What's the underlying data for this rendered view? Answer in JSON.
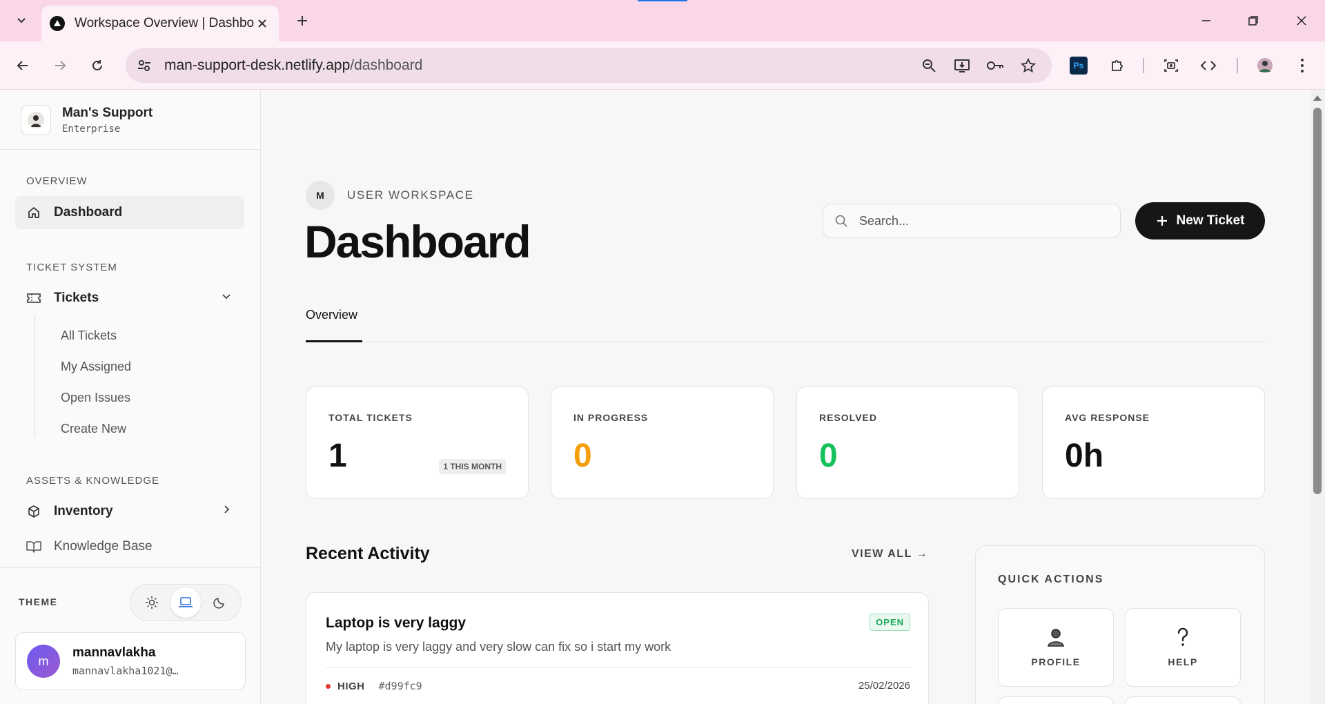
{
  "browser": {
    "tab_title": "Workspace Overview | Dashboa",
    "url_host": "man-support-desk.netlify.app",
    "url_path": "/dashboard"
  },
  "sidebar": {
    "brand_name": "Man's Support",
    "brand_sub": "Enterprise",
    "sections": {
      "overview": "OVERVIEW",
      "ticket_system": "TICKET SYSTEM",
      "assets": "ASSETS & KNOWLEDGE"
    },
    "items": {
      "dashboard": "Dashboard",
      "tickets": "Tickets",
      "inventory": "Inventory",
      "knowledge_base": "Knowledge Base"
    },
    "ticket_sub": [
      "All Tickets",
      "My Assigned",
      "Open Issues",
      "Create New"
    ],
    "theme_label": "THEME",
    "user": {
      "initial": "m",
      "name": "mannavlakha",
      "email": "mannavlakha1021@…"
    }
  },
  "main": {
    "workspace_initial": "M",
    "workspace_label": "USER WORKSPACE",
    "title": "Dashboard",
    "search_placeholder": "Search...",
    "new_ticket": "New Ticket",
    "tabs": [
      "Overview"
    ],
    "stats": [
      {
        "label": "TOTAL TICKETS",
        "value": "1",
        "badge": "1 THIS MONTH",
        "color": "#111111"
      },
      {
        "label": "IN PROGRESS",
        "value": "0",
        "color": "#f59e0b"
      },
      {
        "label": "RESOLVED",
        "value": "0",
        "color": "#16c15c"
      },
      {
        "label": "AVG RESPONSE",
        "value": "0h",
        "color": "#111111"
      }
    ],
    "recent_activity_title": "Recent Activity",
    "view_all": "VIEW ALL →",
    "activity": [
      {
        "title": "Laptop is very laggy",
        "description": "My laptop is very laggy and very slow can fix so i start my work",
        "status": "OPEN",
        "priority": "HIGH",
        "id": "#d99fc9",
        "date": "25/02/2026"
      }
    ],
    "quick_actions_title": "QUICK ACTIONS",
    "quick_actions": [
      "PROFILE",
      "HELP"
    ]
  }
}
